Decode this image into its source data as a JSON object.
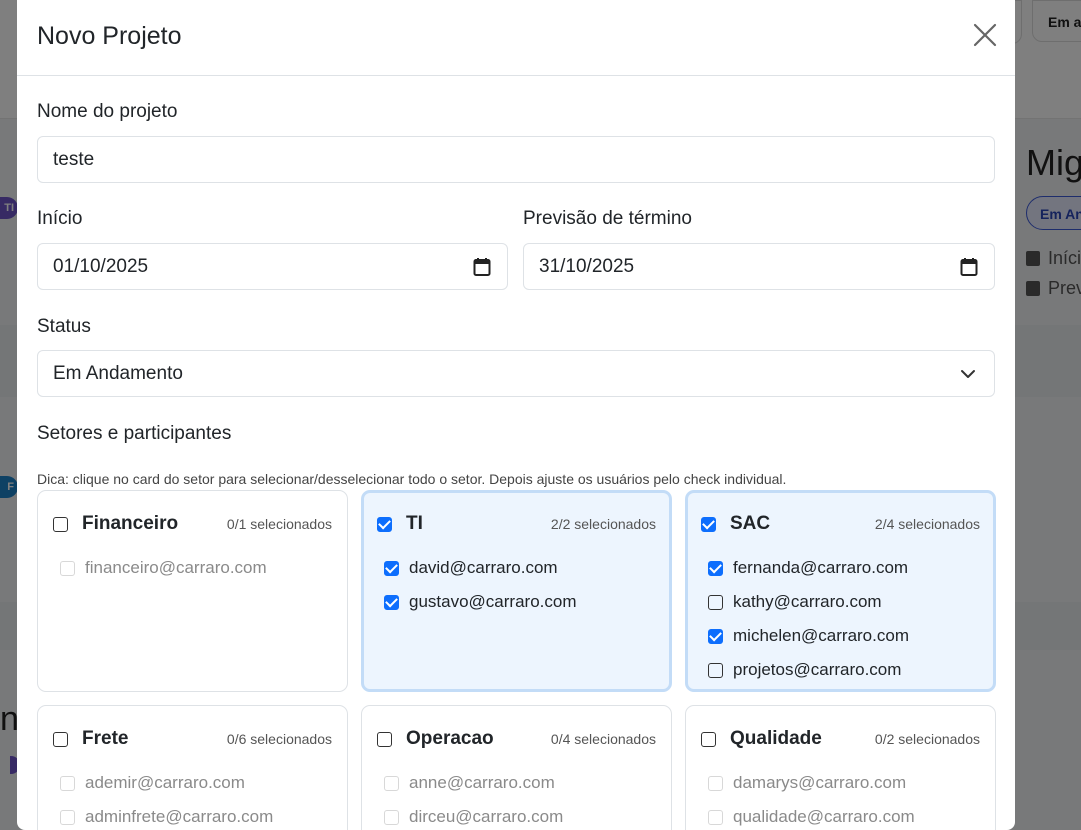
{
  "background": {
    "button_text": "Em a",
    "project_title": "Mig",
    "status_pill": "Em An",
    "meta_start": "Iníci",
    "meta_end": "Prev",
    "avatar_1": "TI",
    "avatar_2": "F",
    "fragment": "n"
  },
  "modal": {
    "title": "Novo Projeto",
    "name_label": "Nome do projeto",
    "name_value": "teste",
    "start_label": "Início",
    "start_value": "01/10/2025",
    "end_label": "Previsão de término",
    "end_value": "31/10/2025",
    "status_label": "Status",
    "status_value": "Em Andamento",
    "sectors_label": "Setores e participantes",
    "hint": "Dica: clique no card do setor para selecionar/desselecionar todo o setor. Depois ajuste os usuários pelo check individual."
  },
  "sectors": [
    {
      "name": "Financeiro",
      "count": "0/1 selecionados",
      "selected": false,
      "users": [
        {
          "email": "financeiro@carraro.com",
          "checked": false,
          "disabled": true
        }
      ]
    },
    {
      "name": "TI",
      "count": "2/2 selecionados",
      "selected": true,
      "users": [
        {
          "email": "david@carraro.com",
          "checked": true,
          "disabled": false
        },
        {
          "email": "gustavo@carraro.com",
          "checked": true,
          "disabled": false
        }
      ]
    },
    {
      "name": "SAC",
      "count": "2/4 selecionados",
      "selected": true,
      "users": [
        {
          "email": "fernanda@carraro.com",
          "checked": true,
          "disabled": false
        },
        {
          "email": "kathy@carraro.com",
          "checked": false,
          "disabled": false
        },
        {
          "email": "michelen@carraro.com",
          "checked": true,
          "disabled": false
        },
        {
          "email": "projetos@carraro.com",
          "checked": false,
          "disabled": false
        }
      ]
    },
    {
      "name": "Frete",
      "count": "0/6 selecionados",
      "selected": false,
      "users": [
        {
          "email": "ademir@carraro.com",
          "checked": false,
          "disabled": true
        },
        {
          "email": "adminfrete@carraro.com",
          "checked": false,
          "disabled": true
        }
      ]
    },
    {
      "name": "Operacao",
      "count": "0/4 selecionados",
      "selected": false,
      "users": [
        {
          "email": "anne@carraro.com",
          "checked": false,
          "disabled": true
        },
        {
          "email": "dirceu@carraro.com",
          "checked": false,
          "disabled": true
        }
      ]
    },
    {
      "name": "Qualidade",
      "count": "0/2 selecionados",
      "selected": false,
      "users": [
        {
          "email": "damarys@carraro.com",
          "checked": false,
          "disabled": true
        },
        {
          "email": "qualidade@carraro.com",
          "checked": false,
          "disabled": true
        }
      ]
    }
  ]
}
